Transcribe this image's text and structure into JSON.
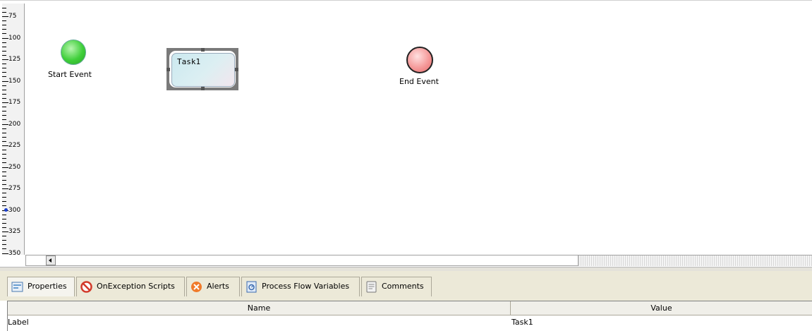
{
  "ruler": {
    "labels": [
      "75",
      "100",
      "125",
      "150",
      "175",
      "200",
      "225",
      "250",
      "275",
      "300",
      "325",
      "350"
    ]
  },
  "diagram": {
    "start_event_label": "Start Event",
    "task_label": "Task1",
    "end_event_label": "End Event"
  },
  "tabs": [
    {
      "label": "Properties",
      "icon": "properties-icon",
      "active": true
    },
    {
      "label": "OnException Scripts",
      "icon": "no-entry-icon",
      "active": false
    },
    {
      "label": "Alerts",
      "icon": "alert-x-icon",
      "active": false
    },
    {
      "label": "Process Flow Variables",
      "icon": "variables-icon",
      "active": false
    },
    {
      "label": "Comments",
      "icon": "comments-icon",
      "active": false
    }
  ],
  "properties_table": {
    "columns": [
      "Name",
      "Value"
    ],
    "rows": [
      {
        "name": "Label",
        "value": "Task1"
      }
    ]
  },
  "colors": {
    "start_event": "#3fcf3a",
    "end_event": "#f59a9a",
    "tab_bar": "#ece9d8"
  }
}
